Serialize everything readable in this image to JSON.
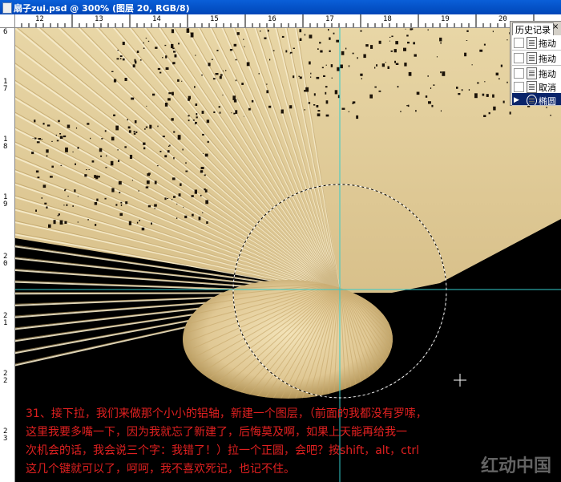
{
  "window": {
    "title": "扇子zui.psd @ 300% (图层 20, RGB/8)"
  },
  "ruler": {
    "top_labels": [
      "12",
      "13",
      "14",
      "15",
      "16",
      "17",
      "18",
      "19",
      "20"
    ],
    "left_labels": [
      "6",
      "1\n7",
      "1\n8",
      "1\n9",
      "2\n0",
      "2\n1",
      "2\n2",
      "2\n3"
    ]
  },
  "history_panel": {
    "tab_label": "历史记录",
    "close_glyph": "×",
    "items": [
      {
        "label": "拖动",
        "icon": "document-icon"
      },
      {
        "label": "拖动",
        "icon": "document-icon"
      },
      {
        "label": "拖动",
        "icon": "document-icon"
      },
      {
        "label": "取消",
        "icon": "document-icon"
      },
      {
        "label": "椭圆",
        "icon": "ellipse-select-icon",
        "active": true
      }
    ]
  },
  "caption": {
    "lines": [
      "31、接下拉，我们来做那个小小的铝轴，新建一个图层，（前面的我都没有罗嗦，",
      "这里我要多嘴一下，因为我就忘了新建了，后悔莫及啊，如果上天能再给我一",
      "次机会的话，我会说三个字：我错了！）拉一个正圆，会吧？按shift，alt，ctrl",
      "这几个键就可以了，呵呵，我不喜欢死记，也记不住。"
    ],
    "color": "#e02020"
  },
  "watermark": "红动中国",
  "colors": {
    "canvas_bg": "#000000",
    "fan_paper": "#e6d2a2",
    "guide_line": "#33cccc",
    "title_bar": "#0a5fd8"
  }
}
